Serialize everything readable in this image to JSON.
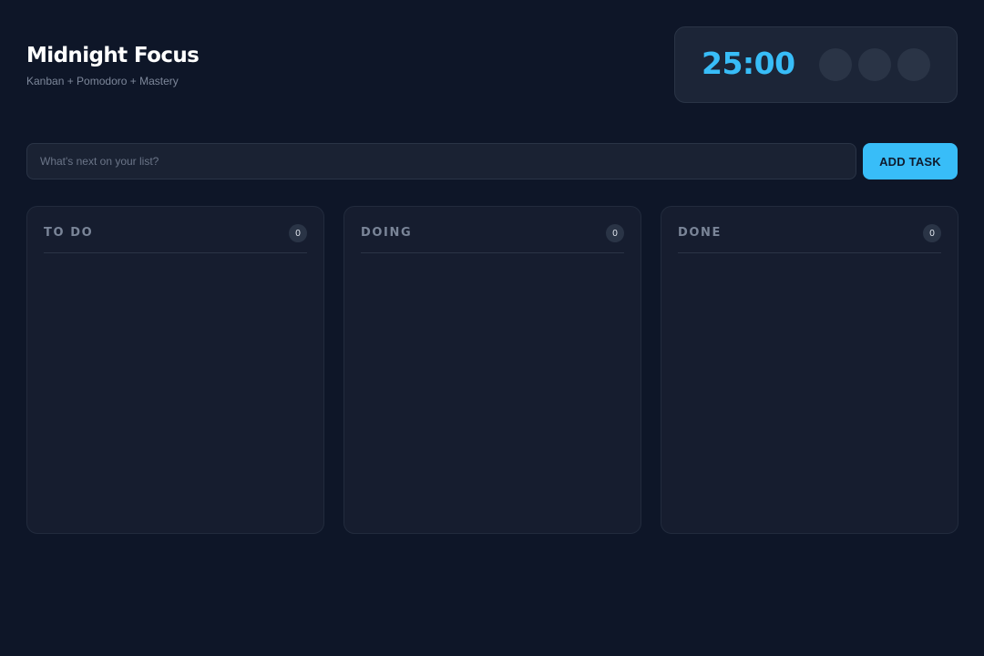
{
  "header": {
    "title": "Midnight Focus",
    "subtitle": "Kanban + Pomodoro + Mastery"
  },
  "timer": {
    "display": "25:00",
    "accent_color": "#38bdf8",
    "controls": [
      {
        "icon": "play-icon"
      },
      {
        "icon": "reset-icon"
      },
      {
        "icon": "settings-icon"
      }
    ]
  },
  "task_entry": {
    "placeholder": "What's next on your list?",
    "value": "",
    "button_label": "ADD TASK",
    "button_color": "#38bdf8"
  },
  "columns": [
    {
      "title": "TO DO",
      "count": "0",
      "tasks": []
    },
    {
      "title": "DOING",
      "count": "0",
      "tasks": []
    },
    {
      "title": "DONE",
      "count": "0",
      "tasks": []
    }
  ],
  "colors": {
    "background": "#0e1628",
    "panel": "#161d2f",
    "card": "#1c2537"
  }
}
